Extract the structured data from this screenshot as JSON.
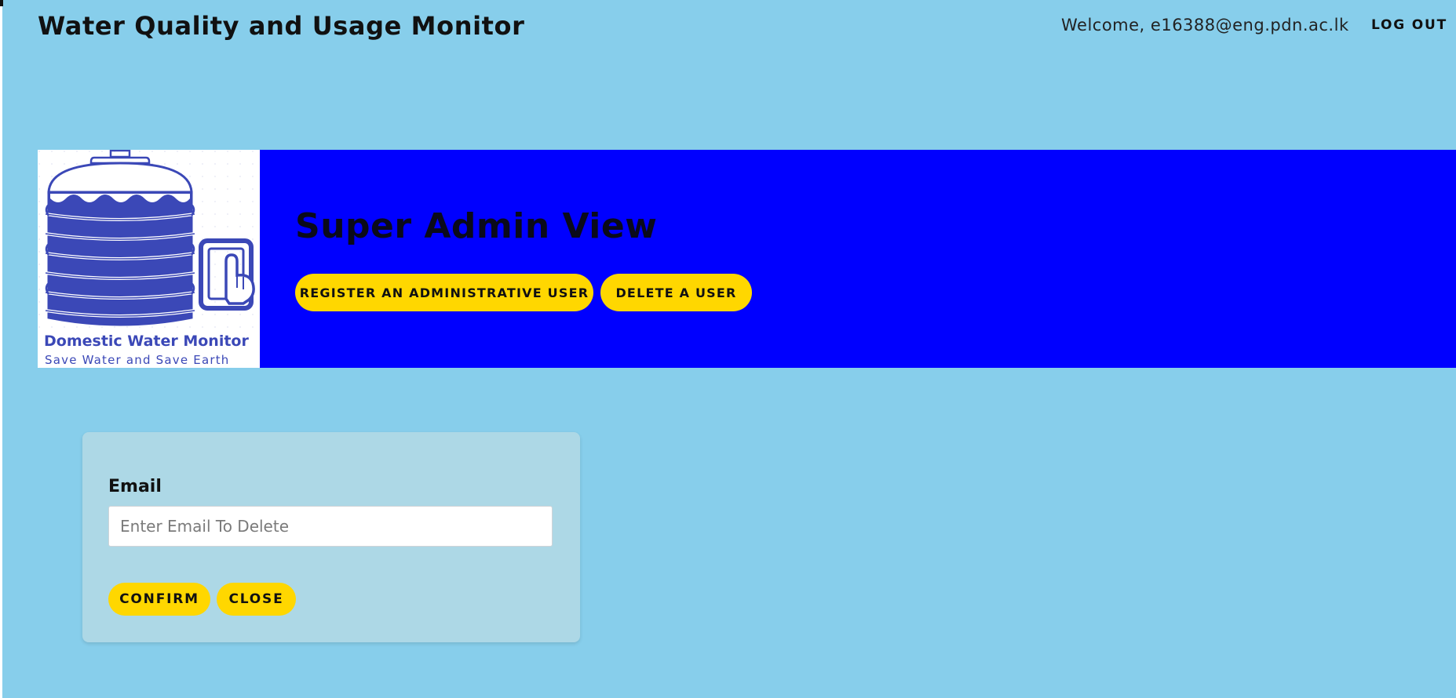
{
  "header": {
    "title": "Water Quality and Usage Monitor",
    "welcome": "Welcome, e16388@eng.pdn.ac.lk",
    "logout_label": "LOG OUT"
  },
  "banner": {
    "logo": {
      "title": "Domestic Water Monitor",
      "subtitle": "Save Water and Save Earth",
      "icon": "water-tank-icon"
    },
    "view_title": "Super Admin View",
    "register_label": "REGISTER AN ADMINISTRATIVE USER",
    "delete_label": "DELETE A USER",
    "background_color": "#0000ff",
    "button_color": "#ffd700"
  },
  "delete_form": {
    "email_label": "Email",
    "email_value": "",
    "email_placeholder": "Enter Email To Delete",
    "confirm_label": "CONFIRM",
    "close_label": "CLOSE"
  },
  "colors": {
    "page_background": "#87ceeb",
    "card_background": "#add8e6",
    "logo_accent": "#3b48b7"
  }
}
